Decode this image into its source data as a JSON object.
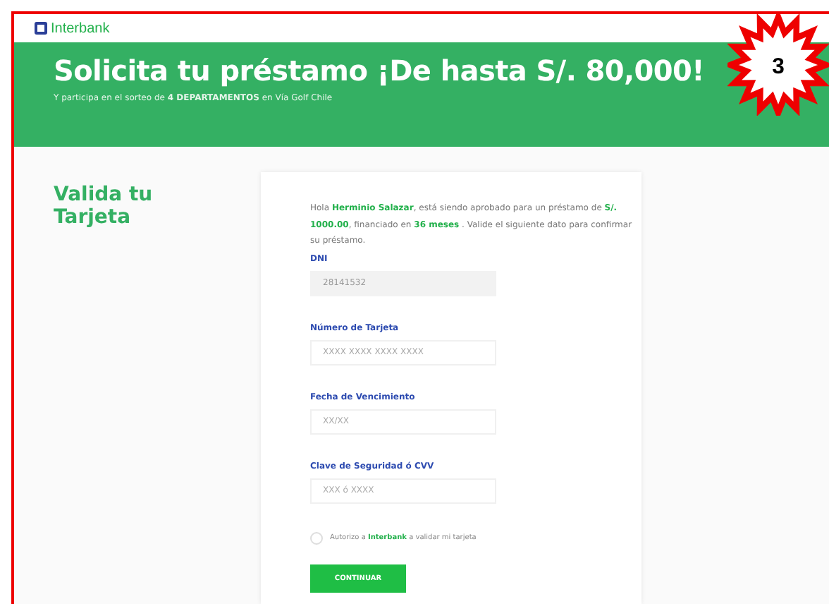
{
  "header": {
    "brand": "Interbank"
  },
  "banner": {
    "title": "Solicita tu préstamo ¡De hasta S/. 80,000!",
    "subtitle": "Y participa en el sorteo de **4 DEPARTAMENTOS** en Vía Golf Chile"
  },
  "badge": {
    "text": "3"
  },
  "section": {
    "heading": "Valida tu Tarjeta"
  },
  "form": {
    "intro": "Hola **Herminio Salazar**, está siendo aprobado para un préstamo de **S/. 1000.00**, financiado en **36 meses** . Valide el siguiente dato para confirmar su préstamo.",
    "fields": [
      {
        "label": "DNI",
        "value": "28141532",
        "disabled": true
      },
      {
        "label": "Número de Tarjeta",
        "placeholder": "XXXX XXXX XXXX XXXX",
        "disabled": false
      },
      {
        "label": "Fecha de Vencimiento",
        "placeholder": "XX/XX",
        "disabled": false
      },
      {
        "label": "Clave de Seguridad ó CVV",
        "placeholder": "XXX ó XXXX",
        "disabled": false
      }
    ],
    "consent": {
      "text": "Autorizo a **Interbank** a validar mi tarjeta",
      "checked": false
    },
    "submit": "CONTINUAR"
  }
}
